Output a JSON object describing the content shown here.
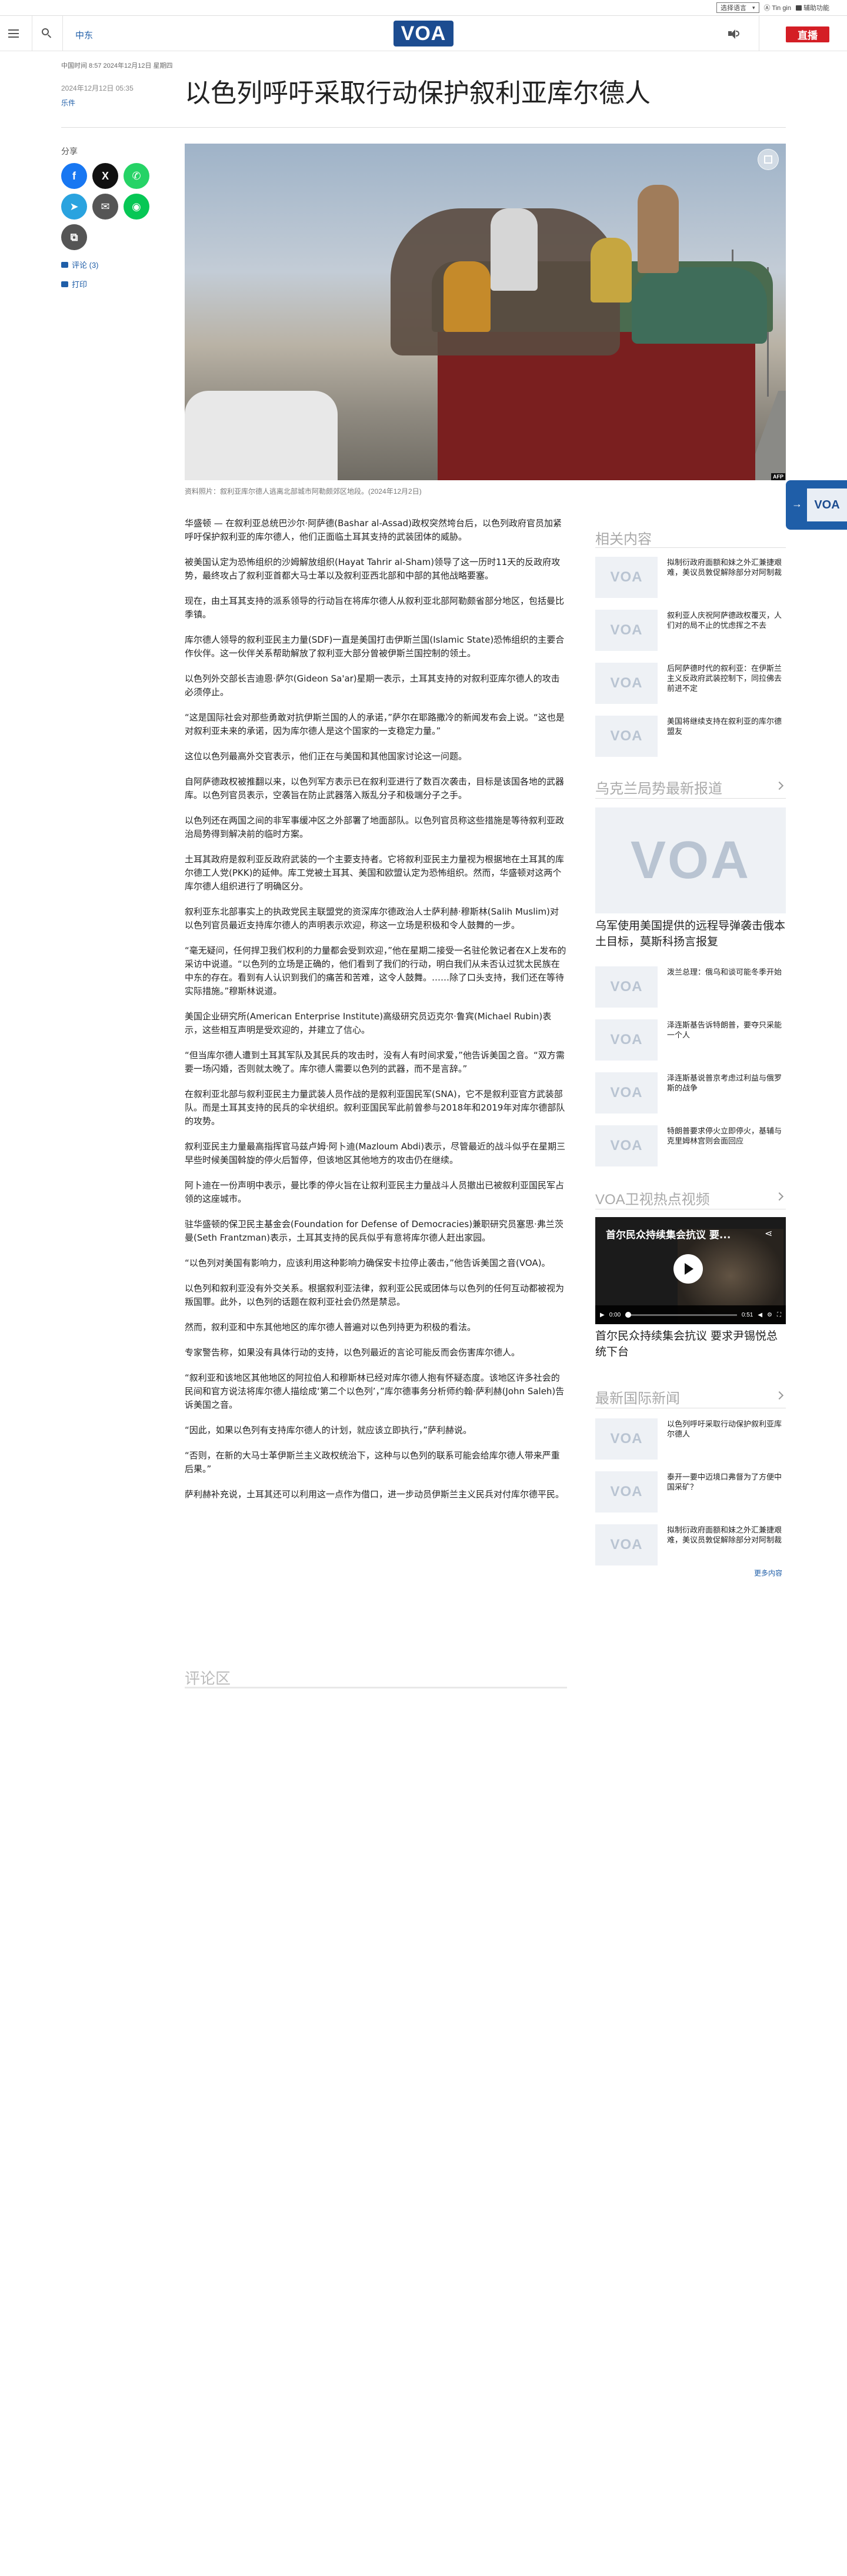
{
  "util_bar": {
    "lang_select": "选择语言",
    "link_font": "Ⓐ Tin gin",
    "link_a11y": "辅助功能"
  },
  "header": {
    "section": "中东",
    "logo": "VOA",
    "live_label": "直播"
  },
  "timestamp_line": "中国时间 8:57 2024年12月12日 星期四",
  "article": {
    "date": "2024年12月12日 05:35",
    "category": "乐件",
    "headline": "以色列呼吁采取行动保护叙利亚库尔德人",
    "image_caption": "资料照片：叙利亚库尔德人逃离北部城市阿勒颇郊区地段。(2024年12月2日)",
    "image_credit": "AFP",
    "paragraphs": [
      "华盛顿 — 在叙利亚总统巴沙尔·阿萨德(Bashar al-Assad)政权突然垮台后，以色列政府官员加紧呼吁保护叙利亚的库尔德人，他们正面临土耳其支持的武装团体的威胁。",
      "被美国认定为恐怖组织的沙姆解放组织(Hayat Tahrir al-Sham)领导了这一历时11天的反政府攻势，最终攻占了叙利亚首都大马士革以及叙利亚西北部和中部的其他战略要塞。",
      "现在，由土耳其支持的派系领导的行动旨在将库尔德人从叙利亚北部阿勒颇省部分地区，包括曼比季镇。",
      "库尔德人领导的叙利亚民主力量(SDF)一直是美国打击伊斯兰国(Islamic State)恐怖组织的主要合作伙伴。这一伙伴关系帮助解放了叙利亚大部分曾被伊斯兰国控制的领土。",
      "以色列外交部长吉迪恩·萨尔(Gideon Sa'ar)星期一表示，土耳其支持的对叙利亚库尔德人的攻击必须停止。",
      "“这是国际社会对那些勇敢对抗伊斯兰国的人的承诺，”萨尔在耶路撒冷的新闻发布会上说。“这也是对叙利亚未来的承诺，因为库尔德人是这个国家的一支稳定力量。”",
      "这位以色列最高外交官表示，他们正在与美国和其他国家讨论这一问题。",
      "自阿萨德政权被推翻以来，以色列军方表示已在叙利亚进行了数百次袭击，目标是该国各地的武器库。以色列官员表示，空袭旨在防止武器落入叛乱分子和极端分子之手。",
      "以色列还在两国之间的非军事缓冲区之外部署了地面部队。以色列官员称这些措施是等待叙利亚政治局势得到解决前的临时方案。",
      "土耳其政府是叙利亚反政府武装的一个主要支持者。它将叙利亚民主力量视为根据地在土耳其的库尔德工人党(PKK)的延伸。库工党被土耳其、美国和欧盟认定为恐怖组织。然而，华盛顿对这两个库尔德人组织进行了明确区分。",
      "叙利亚东北部事实上的执政党民主联盟党的资深库尔德政治人士萨利赫·穆斯林(Salih Muslim)对以色列官员最近支持库尔德人的声明表示欢迎，称这一立场是积极和令人鼓舞的一步。",
      "“毫无疑问，任何捍卫我们权利的力量都会受到欢迎，”他在星期二接受一名驻伦敦记者在X上发布的采访中说道。“以色列的立场是正确的，他们看到了我们的行动，明白我们从未否认过犹太民族在中东的存在。看到有人认识到我们的痛苦和苦难，这令人鼓舞。……除了口头支持，我们还在等待实际措施。”穆斯林说道。",
      "美国企业研究所(American Enterprise Institute)高级研究员迈克尔·鲁宾(Michael Rubin)表示，这些相互声明是受欢迎的，并建立了信心。",
      "“但当库尔德人遭到土耳其军队及其民兵的攻击时，没有人有时间求爱，”他告诉美国之音。“双方需要一场闪婚，否则就太晚了。库尔德人需要以色列的武器，而不是言辞。”",
      "在叙利亚北部与叙利亚民主力量武装人员作战的是叙利亚国民军(SNA)，它不是叙利亚官方武装部队。而是土耳其支持的民兵的伞状组织。叙利亚国民军此前曾参与2018年和2019年对库尔德部队的攻势。",
      "叙利亚民主力量最高指挥官马兹卢姆·阿卜迪(Mazloum Abdi)表示，尽管最近的战斗似乎在星期三早些时候美国斡旋的停火后暂停，但该地区其他地方的攻击仍在继续。",
      "阿卜迪在一份声明中表示，曼比季的停火旨在让叙利亚民主力量战斗人员撤出已被叙利亚国民军占领的这座城市。",
      "驻华盛顿的保卫民主基金会(Foundation for Defense of Democracies)兼职研究员塞思·弗兰茨曼(Seth Frantzman)表示，土耳其支持的民兵似乎有意将库尔德人赶出家园。",
      "“以色列对美国有影响力，应该利用这种影响力确保安卡拉停止袭击，”他告诉美国之音(VOA)。",
      "以色列和叙利亚没有外交关系。根据叙利亚法律，叙利亚公民或团体与以色列的任何互动都被视为叛国罪。此外，以色列的话题在叙利亚社会仍然是禁忌。",
      "然而，叙利亚和中东其他地区的库尔德人普遍对以色列持更为积极的看法。",
      "专家警告称，如果没有具体行动的支持，以色列最近的言论可能反而会伤害库尔德人。",
      "“叙利亚和该地区其他地区的阿拉伯人和穆斯林已经对库尔德人抱有怀疑态度。该地区许多社会的民间和官方说法将库尔德人描绘成‘第二个以色列’，”库尔德事务分析师约翰·萨利赫(John Saleh)告诉美国之音。",
      "“因此，如果以色列有支持库尔德人的计划，就应该立即执行，”萨利赫说。",
      "“否则，在新的大马士革伊斯兰主义政权统治下，这种与以色列的联系可能会给库尔德人带来严重后果。”",
      "萨利赫补充说，土耳其还可以利用这一点作为借口，进一步动员伊斯兰主义民兵对付库尔德平民。"
    ],
    "comments_title": "评论区"
  },
  "share": {
    "label": "分享",
    "comments": "评论 (3)",
    "print": "打印"
  },
  "sidebar": {
    "related_title": "相关内容",
    "related": [
      "拟制衍政府面额和妹之外汇兼捷艰难，美议员敦促解除部分对阿制裁",
      "叙利亚人庆祝阿萨德政权覆灭，人们对的局不止的忧虑挥之不去",
      "后阿萨德时代的叙利亚：在伊斯兰主义反政府武装控制下，同拉佛去前进不定",
      "美国将继续支持在叙利亚的库尔德盟友"
    ],
    "ukraine_title": "乌克兰局势最新报道",
    "ukraine_feature": "乌军使用美国提供的远程导弹袭击俄本土目标，莫斯科扬言报复",
    "ukraine": [
      "泼兰总理：俄乌和谈可能冬季开始",
      "泽连斯基告诉特朗普，要夺只采能一个人",
      "泽连斯基说普京考虑过利益与俄罗斯的战争",
      "特朗普要求停火立即停火，基辅与克里姆林宫则会面回应"
    ],
    "video_title": "VOA卫视热点视频",
    "video_overlay": "首尔民众持续集会抗议 要...",
    "video_time": "0:00",
    "video_duration": "0:51",
    "video_caption": "首尔民众持续集会抗议 要求尹锡悦总统下台",
    "news_title": "最新国际新闻",
    "news": [
      "以色列呼吁采取行动保护叙利亚库尔德人",
      "泰开一要中迈境口弗督为了方便中国采矿？",
      "拟制衍政府面额和妹之外汇兼捷艰难，美议员敦促解除部分对阿制裁"
    ],
    "more": "更多内容"
  },
  "colors": {
    "brand": "#1c4c90",
    "link": "#1f5ea8",
    "live": "#d41e25"
  },
  "icons": [
    "menu-icon",
    "search-icon",
    "audio-icon",
    "facebook-icon",
    "x-icon",
    "whatsapp-icon",
    "telegram-icon",
    "email-icon",
    "line-icon",
    "copy-icon",
    "comment-icon",
    "print-icon",
    "expand-icon",
    "play-icon",
    "share-icon",
    "chevron-right-icon"
  ]
}
